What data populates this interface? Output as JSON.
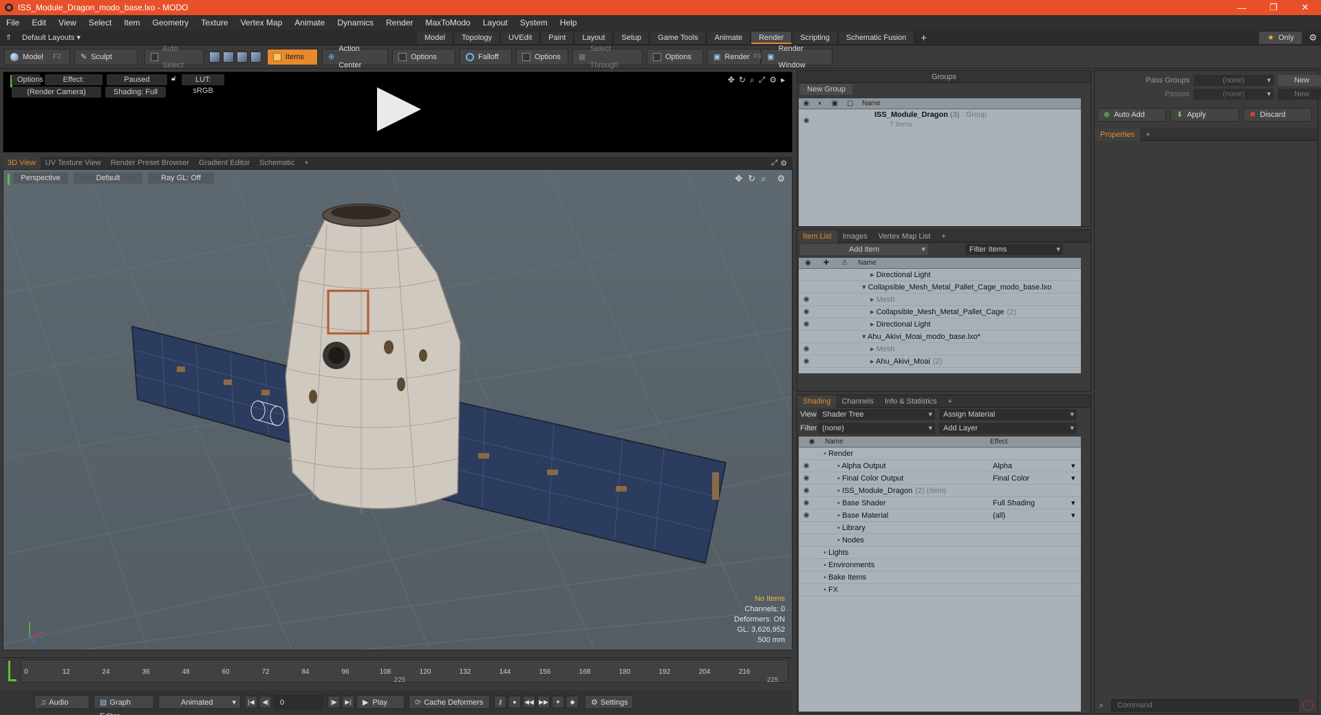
{
  "window": {
    "title": "ISS_Module_Dragon_modo_base.lxo - MODO",
    "minimize": "—",
    "restore": "❐",
    "close": "✕"
  },
  "menu": [
    "File",
    "Edit",
    "View",
    "Select",
    "Item",
    "Geometry",
    "Texture",
    "Vertex Map",
    "Animate",
    "Dynamics",
    "Render",
    "MaxToModo",
    "Layout",
    "System",
    "Help"
  ],
  "layouts": {
    "label": "Default Layouts ▾",
    "tabs": [
      "Model",
      "Topology",
      "UVEdit",
      "Paint",
      "Layout",
      "Setup",
      "Game Tools",
      "Animate",
      "Render",
      "Scripting",
      "Schematic Fusion"
    ],
    "active": "Render",
    "only": "Only"
  },
  "toolbar": {
    "model": "Model",
    "model_key": "F2",
    "sculpt": "Sculpt",
    "auto_select": "Auto Select",
    "items": "Items",
    "action_center": "Action Center",
    "options1": "Options",
    "falloff": "Falloff",
    "options2": "Options",
    "select_through": "Select Through",
    "options3": "Options",
    "render": "Render",
    "render_key": "F9",
    "render_window": "Render Window"
  },
  "preview": {
    "options": "Options",
    "effect": "Effect: (Shadi...",
    "paused": "Paused",
    "lut": "LUT: sRGB",
    "camera": "(Render Camera)",
    "shading": "Shading: Full"
  },
  "viewport_tabs": [
    "3D View",
    "UV Texture View",
    "Render Preset Browser",
    "Gradient Editor",
    "Schematic"
  ],
  "viewport": {
    "perspective": "Perspective",
    "default": "Default",
    "raygl": "Ray GL: Off",
    "info": {
      "items": "No Items",
      "channels": "Channels: 0",
      "deformers": "Deformers: ON",
      "gl": "GL: 3,626,952",
      "scale": "500 mm"
    }
  },
  "timeline": {
    "ticks": [
      "0",
      "12",
      "24",
      "36",
      "48",
      "60",
      "72",
      "84",
      "96",
      "108",
      "120",
      "132",
      "144",
      "156",
      "168",
      "180",
      "192",
      "204",
      "216"
    ],
    "bottom_ticks": [
      "225",
      "225"
    ]
  },
  "bottombar": {
    "audio": "Audio",
    "graph_editor": "Graph Editor",
    "animated": "Animated",
    "frame": "0",
    "play": "Play",
    "cache": "Cache Deformers",
    "settings": "Settings"
  },
  "groups": {
    "title": "Groups",
    "new_group": "New Group",
    "col_name": "Name",
    "item_name": "ISS_Module_Dragon",
    "item_count": "(3)",
    "item_type": ": Group",
    "item_sub": "7 Items"
  },
  "itemlist": {
    "tabs": [
      "Item List",
      "Images",
      "Vertex Map List"
    ],
    "add_item": "Add Item",
    "filter": "Filter Items",
    "col_name": "Name",
    "rows": [
      {
        "name": "Directional Light",
        "indent": 1,
        "eye": false,
        "grey": false,
        "sub": ""
      },
      {
        "name": "Collapsible_Mesh_Metal_Pallet_Cage_modo_base.lxo",
        "indent": 0,
        "eye": false,
        "grey": false,
        "sub": ""
      },
      {
        "name": "Mesh",
        "indent": 1,
        "eye": true,
        "grey": true,
        "sub": ""
      },
      {
        "name": "Collapsible_Mesh_Metal_Pallet_Cage",
        "indent": 1,
        "eye": true,
        "grey": false,
        "sub": "(2)"
      },
      {
        "name": "Directional Light",
        "indent": 1,
        "eye": true,
        "grey": false,
        "sub": ""
      },
      {
        "name": "Ahu_Akivi_Moai_modo_base.lxo*",
        "indent": 0,
        "eye": false,
        "grey": false,
        "sub": ""
      },
      {
        "name": "Mesh",
        "indent": 1,
        "eye": true,
        "grey": true,
        "sub": ""
      },
      {
        "name": "Ahu_Akivi_Moai",
        "indent": 1,
        "eye": true,
        "grey": false,
        "sub": "(2)"
      }
    ]
  },
  "shading": {
    "tabs": [
      "Shading",
      "Channels",
      "Info & Statistics"
    ],
    "view_label": "View",
    "view_value": "Shader Tree",
    "assign": "Assign Material",
    "filter_label": "Filter",
    "filter_value": "(none)",
    "add_layer": "Add Layer",
    "col_name": "Name",
    "col_effect": "Effect",
    "rows": [
      {
        "name": "Render",
        "effect": "",
        "indent": 0,
        "eye": false,
        "sub": ""
      },
      {
        "name": "Alpha Output",
        "effect": "Alpha",
        "indent": 1,
        "eye": true,
        "sub": ""
      },
      {
        "name": "Final Color Output",
        "effect": "Final Color",
        "indent": 1,
        "eye": true,
        "sub": ""
      },
      {
        "name": "ISS_Module_Dragon",
        "effect": "",
        "indent": 1,
        "eye": true,
        "sub": "(2) (Item)"
      },
      {
        "name": "Base Shader",
        "effect": "Full Shading",
        "indent": 1,
        "eye": true,
        "sub": ""
      },
      {
        "name": "Base Material",
        "effect": "(all)",
        "indent": 1,
        "eye": true,
        "sub": ""
      },
      {
        "name": "Library",
        "effect": "",
        "indent": 1,
        "eye": false,
        "sub": ""
      },
      {
        "name": "Nodes",
        "effect": "",
        "indent": 1,
        "eye": false,
        "sub": ""
      },
      {
        "name": "Lights",
        "effect": "",
        "indent": 0,
        "eye": false,
        "sub": ""
      },
      {
        "name": "Environments",
        "effect": "",
        "indent": 0,
        "eye": false,
        "sub": ""
      },
      {
        "name": "Bake Items",
        "effect": "",
        "indent": 0,
        "eye": false,
        "sub": ""
      },
      {
        "name": "FX",
        "effect": "",
        "indent": 0,
        "eye": false,
        "sub": ""
      }
    ]
  },
  "properties": {
    "pass_groups": "Pass Groups",
    "pass_groups_val": "(none)",
    "passes": "Passes",
    "passes_val": "(none)",
    "new": "New",
    "auto_add": "Auto Add",
    "apply": "Apply",
    "discard": "Discard",
    "tab": "Properties",
    "command": "Command"
  },
  "colors": {
    "accent": "#e88a2c",
    "titlebar": "#e8502a",
    "list_bg": "#a9b2b9"
  }
}
